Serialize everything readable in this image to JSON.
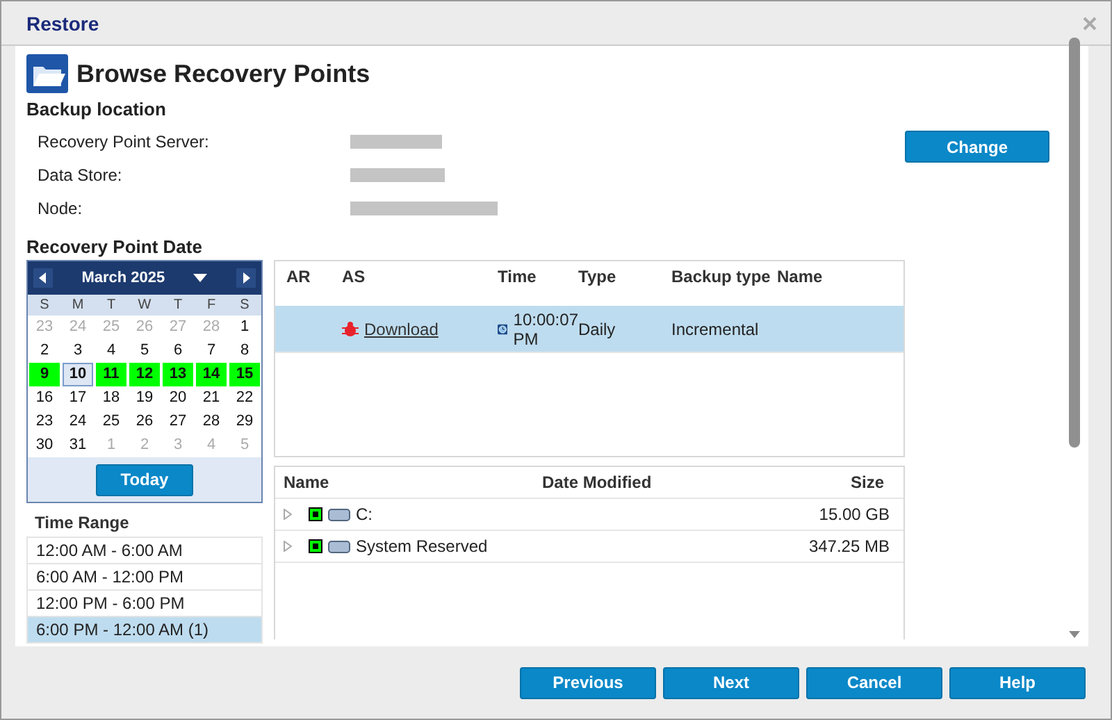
{
  "window": {
    "title": "Restore"
  },
  "heading": "Browse Recovery Points",
  "backup_location": {
    "title": "Backup location",
    "fields": [
      {
        "label": "Recovery Point Server:",
        "redacted": true
      },
      {
        "label": "Data Store:",
        "redacted": true
      },
      {
        "label": "Node:",
        "redacted": true
      }
    ],
    "change_button": "Change"
  },
  "recovery_point_date": {
    "title": "Recovery Point Date"
  },
  "calendar": {
    "month": "March 2025",
    "weekdays": [
      "S",
      "M",
      "T",
      "W",
      "T",
      "F",
      "S"
    ],
    "days": [
      {
        "d": "23",
        "muted": true,
        "backup": false,
        "selected": false
      },
      {
        "d": "24",
        "muted": true,
        "backup": false,
        "selected": false
      },
      {
        "d": "25",
        "muted": true,
        "backup": false,
        "selected": false
      },
      {
        "d": "26",
        "muted": true,
        "backup": false,
        "selected": false
      },
      {
        "d": "27",
        "muted": true,
        "backup": false,
        "selected": false
      },
      {
        "d": "28",
        "muted": true,
        "backup": false,
        "selected": false
      },
      {
        "d": "1",
        "muted": false,
        "backup": false,
        "selected": false
      },
      {
        "d": "2",
        "muted": false,
        "backup": false,
        "selected": false
      },
      {
        "d": "3",
        "muted": false,
        "backup": false,
        "selected": false
      },
      {
        "d": "4",
        "muted": false,
        "backup": false,
        "selected": false
      },
      {
        "d": "5",
        "muted": false,
        "backup": false,
        "selected": false
      },
      {
        "d": "6",
        "muted": false,
        "backup": false,
        "selected": false
      },
      {
        "d": "7",
        "muted": false,
        "backup": false,
        "selected": false
      },
      {
        "d": "8",
        "muted": false,
        "backup": false,
        "selected": false
      },
      {
        "d": "9",
        "muted": false,
        "backup": true,
        "selected": false
      },
      {
        "d": "10",
        "muted": false,
        "backup": false,
        "selected": true
      },
      {
        "d": "11",
        "muted": false,
        "backup": true,
        "selected": false
      },
      {
        "d": "12",
        "muted": false,
        "backup": true,
        "selected": false
      },
      {
        "d": "13",
        "muted": false,
        "backup": true,
        "selected": false
      },
      {
        "d": "14",
        "muted": false,
        "backup": true,
        "selected": false
      },
      {
        "d": "15",
        "muted": false,
        "backup": true,
        "selected": false
      },
      {
        "d": "16",
        "muted": false,
        "backup": false,
        "selected": false
      },
      {
        "d": "17",
        "muted": false,
        "backup": false,
        "selected": false
      },
      {
        "d": "18",
        "muted": false,
        "backup": false,
        "selected": false
      },
      {
        "d": "19",
        "muted": false,
        "backup": false,
        "selected": false
      },
      {
        "d": "20",
        "muted": false,
        "backup": false,
        "selected": false
      },
      {
        "d": "21",
        "muted": false,
        "backup": false,
        "selected": false
      },
      {
        "d": "22",
        "muted": false,
        "backup": false,
        "selected": false
      },
      {
        "d": "23",
        "muted": false,
        "backup": false,
        "selected": false
      },
      {
        "d": "24",
        "muted": false,
        "backup": false,
        "selected": false
      },
      {
        "d": "25",
        "muted": false,
        "backup": false,
        "selected": false
      },
      {
        "d": "26",
        "muted": false,
        "backup": false,
        "selected": false
      },
      {
        "d": "27",
        "muted": false,
        "backup": false,
        "selected": false
      },
      {
        "d": "28",
        "muted": false,
        "backup": false,
        "selected": false
      },
      {
        "d": "29",
        "muted": false,
        "backup": false,
        "selected": false
      },
      {
        "d": "30",
        "muted": false,
        "backup": false,
        "selected": false
      },
      {
        "d": "31",
        "muted": false,
        "backup": false,
        "selected": false
      },
      {
        "d": "1",
        "muted": true,
        "backup": false,
        "selected": false
      },
      {
        "d": "2",
        "muted": true,
        "backup": false,
        "selected": false
      },
      {
        "d": "3",
        "muted": true,
        "backup": false,
        "selected": false
      },
      {
        "d": "4",
        "muted": true,
        "backup": false,
        "selected": false
      },
      {
        "d": "5",
        "muted": true,
        "backup": false,
        "selected": false
      }
    ],
    "today_button": "Today"
  },
  "time_range": {
    "title": "Time Range",
    "items": [
      {
        "label": "12:00 AM - 6:00 AM",
        "selected": false
      },
      {
        "label": "6:00 AM - 12:00 PM",
        "selected": false
      },
      {
        "label": "12:00 PM - 6:00 PM",
        "selected": false
      },
      {
        "label": "6:00 PM - 12:00 AM (1)",
        "selected": true
      }
    ]
  },
  "recovery_points": {
    "columns": [
      "AR",
      "AS",
      "Time",
      "Type",
      "Backup type",
      "Name"
    ],
    "rows": [
      {
        "as_link": "Download",
        "time": "10:00:07 PM",
        "type": "Daily",
        "backup_type": "Incremental",
        "selected": true
      }
    ]
  },
  "files": {
    "columns": [
      "Name",
      "Date Modified",
      "Size"
    ],
    "rows": [
      {
        "name": "C:",
        "size": "15.00 GB",
        "checked": true
      },
      {
        "name": "System Reserved",
        "size": "347.25 MB",
        "checked": true
      }
    ]
  },
  "buttons": [
    "Previous",
    "Next",
    "Cancel",
    "Help"
  ]
}
